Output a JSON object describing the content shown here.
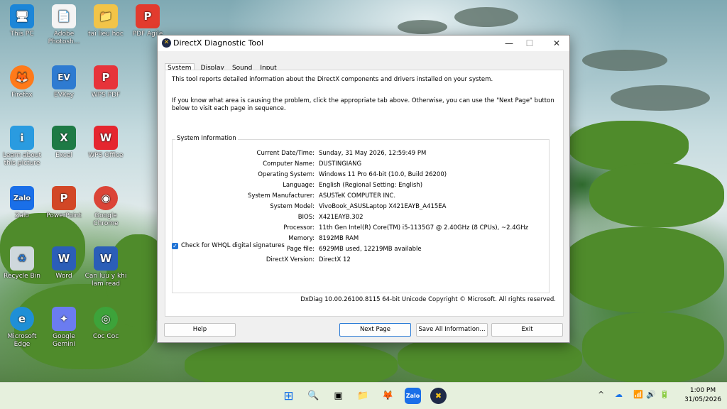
{
  "desktop": {
    "icons": [
      {
        "label": "This PC",
        "glyph": "🖥"
      },
      {
        "label": "Adobe Photosh...",
        "glyph": "📄"
      },
      {
        "label": "tai lieu hoc",
        "glyph": "📁"
      },
      {
        "label": "PDF Agile",
        "glyph": "P"
      },
      {
        "label": "Firefox",
        "glyph": "🦊"
      },
      {
        "label": "EVKey",
        "glyph": "EV"
      },
      {
        "label": "WPS PDF",
        "glyph": "P"
      },
      {
        "label": "Learn about this picture",
        "glyph": "ℹ"
      },
      {
        "label": "Excel",
        "glyph": "X"
      },
      {
        "label": "WPS Office",
        "glyph": "W"
      },
      {
        "label": "Zalo",
        "glyph": "Zalo"
      },
      {
        "label": "PowerPoint",
        "glyph": "P"
      },
      {
        "label": "Google Chrome",
        "glyph": "◉"
      },
      {
        "label": "Recycle Bin",
        "glyph": "♻"
      },
      {
        "label": "Word",
        "glyph": "W"
      },
      {
        "label": "Can luu y khi lam read",
        "glyph": "W"
      },
      {
        "label": "Microsoft Edge",
        "glyph": "e"
      },
      {
        "label": "Google Gemini",
        "glyph": "✦"
      },
      {
        "label": "Coc Coc",
        "glyph": "◎"
      }
    ]
  },
  "window": {
    "title": "DirectX Diagnostic Tool",
    "minimize": "—",
    "maximize": "☐",
    "close": "✕",
    "tabs": [
      "System",
      "Display",
      "Sound",
      "Input"
    ],
    "intro": "This tool reports detailed information about the DirectX components and drivers installed on your system.",
    "help_text": "If you know what area is causing the problem, click the appropriate tab above.  Otherwise, you can use the \"Next Page\" button below to visit each page in sequence.",
    "group_title": "System Information",
    "rows": [
      {
        "label": "Current Date/Time:",
        "value": "Sunday, 31 May 2026, 12:59:49 PM"
      },
      {
        "label": "Computer Name:",
        "value": "DUSTINGIANG"
      },
      {
        "label": "Operating System:",
        "value": "Windows 11 Pro 64-bit (10.0, Build 26200)"
      },
      {
        "label": "Language:",
        "value": "English (Regional Setting: English)"
      },
      {
        "label": "System Manufacturer:",
        "value": "ASUSTeK COMPUTER INC."
      },
      {
        "label": "System Model:",
        "value": "VivoBook_ASUSLaptop X421EAYB_A415EA"
      },
      {
        "label": "BIOS:",
        "value": "X421EAYB.302"
      },
      {
        "label": "Processor:",
        "value": "11th Gen Intel(R) Core(TM) i5-1135G7 @ 2.40GHz (8 CPUs), ~2.4GHz"
      },
      {
        "label": "Memory:",
        "value": "8192MB RAM"
      },
      {
        "label": "Page file:",
        "value": "6929MB used, 12219MB available"
      },
      {
        "label": "DirectX Version:",
        "value": "DirectX 12"
      }
    ],
    "checkbox_label": "Check for WHQL digital signatures",
    "footer": "DxDiag 10.00.26100.8115 64-bit Unicode  Copyright © Microsoft. All rights reserved.",
    "buttons": {
      "help": "Help",
      "next": "Next Page",
      "save": "Save All Information...",
      "exit": "Exit"
    }
  },
  "taskbar": {
    "apps": [
      "⊞",
      "🔍",
      "▣",
      "📁",
      "🦊",
      "Zalo",
      "✖"
    ],
    "tray": [
      "^",
      "☁",
      "📶",
      "🔊",
      "🔋"
    ],
    "time": "1:00 PM",
    "date": "31/05/2026"
  }
}
